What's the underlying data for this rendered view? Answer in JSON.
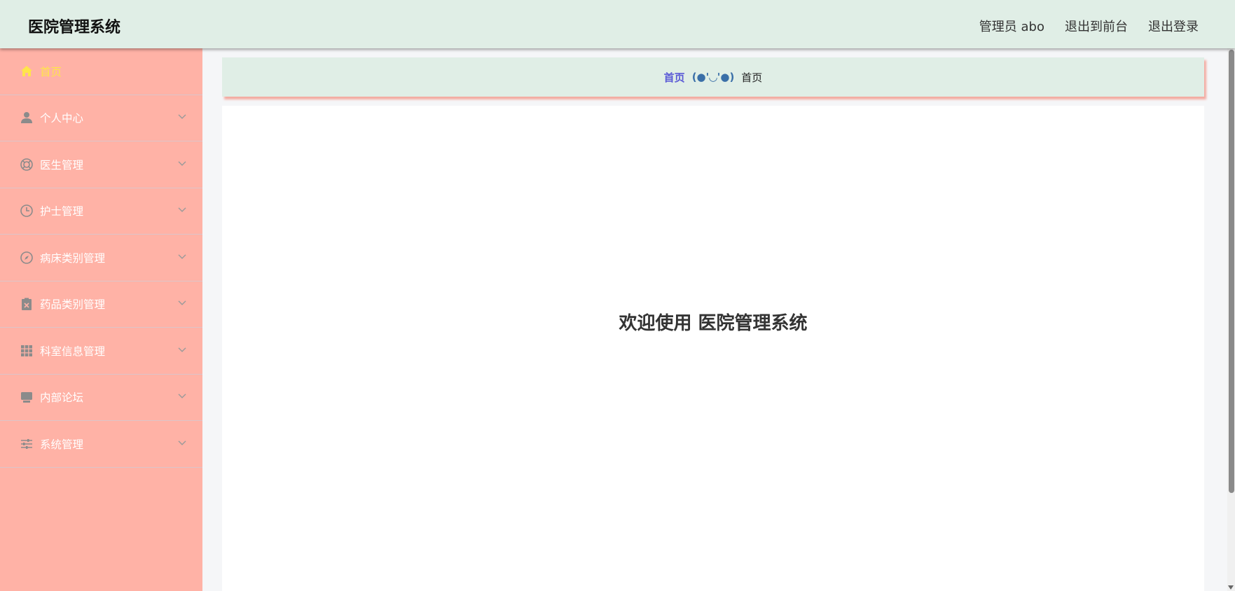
{
  "app": {
    "title": "医院管理系统"
  },
  "header": {
    "user_label": "管理员 abo",
    "front_label": "退出到前台",
    "logout_label": "退出登录"
  },
  "sidebar": {
    "items": [
      {
        "label": "首页",
        "icon": "home-icon",
        "active": true
      },
      {
        "label": "个人中心",
        "icon": "user-icon"
      },
      {
        "label": "医生管理",
        "icon": "lifebuoy-icon"
      },
      {
        "label": "护士管理",
        "icon": "clock-icon"
      },
      {
        "label": "病床类别管理",
        "icon": "compass-icon"
      },
      {
        "label": "药品类别管理",
        "icon": "clipboard-x-icon"
      },
      {
        "label": "科室信息管理",
        "icon": "grid-icon"
      },
      {
        "label": "内部论坛",
        "icon": "monitor-icon"
      },
      {
        "label": "系统管理",
        "icon": "sliders-icon"
      }
    ]
  },
  "breadcrumb": {
    "home": "首页",
    "separator": "(●'◡'●)",
    "current": "首页"
  },
  "main": {
    "welcome": "欢迎使用 医院管理系统"
  },
  "colors": {
    "header_bg": "#e0eee6",
    "sidebar_bg": "#ffb2a6",
    "active_text": "#ffe54a",
    "breadcrumb_home": "#5b5bd6"
  }
}
